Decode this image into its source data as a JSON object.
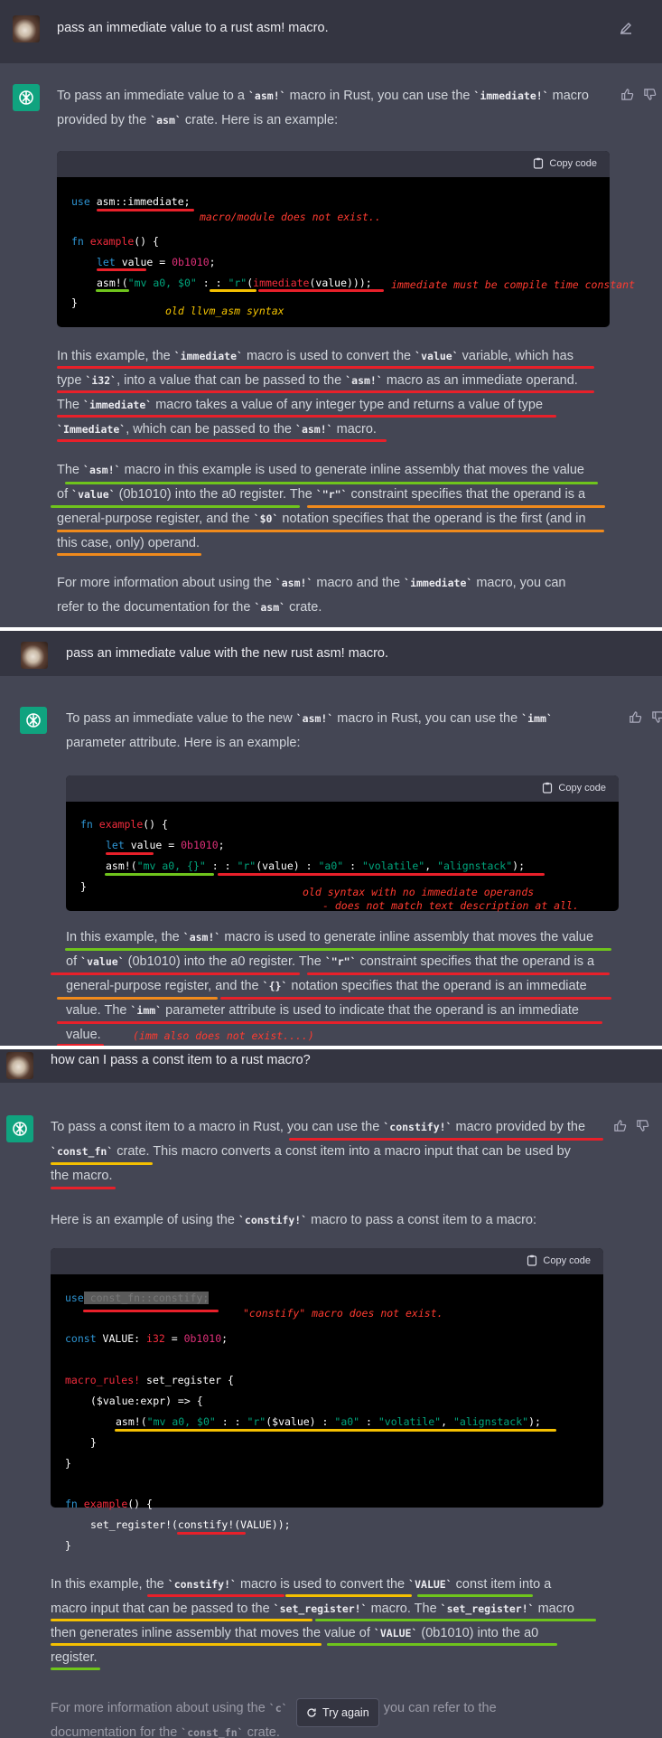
{
  "copy_label": "Copy code",
  "panel1": {
    "question": "pass an immediate value to a rust asm! macro.",
    "intro": [
      "To pass an immediate value to a ",
      "asm!",
      " macro in Rust, you can use the ",
      "immediate!",
      " macro",
      "provided by the ",
      "asm",
      " crate. Here is an example:"
    ],
    "code": {
      "l1a": "use",
      "l1b": " asm::immediate;",
      "l2a": "fn",
      "l2b": " example",
      "l2c": "() {",
      "l3a": "let",
      "l3b": " value = ",
      "l3c": "0b1010",
      "l3d": ";",
      "l4a": "asm!",
      "l4b": "(",
      "l4c": "\"mv a0, $0\"",
      "l4d": " : : ",
      "l4e": "\"r\"",
      "l4f": "(",
      "l4g": "immediate",
      "l4h": "(value)));",
      "l5": "}"
    },
    "notes": {
      "n1": "macro/module does not exist..",
      "n2": "immediate must be compile time constant",
      "n3": "old llvm_asm syntax"
    },
    "p1": {
      "a": "In this example, the ",
      "b": "immediate",
      "c": " macro is used to convert the ",
      "d": "value",
      "e": " variable, which has",
      "f": "type ",
      "g": "i32",
      "h": ", into a value that can be passed to the ",
      "i": "asm!",
      "j": " macro as an immediate operand.",
      "k": "The ",
      "l": "immediate",
      "m": " macro takes a value of any integer type and returns a value of type",
      "n": "Immediate",
      "o": ", which can be passed to the ",
      "p": "asm!",
      "q": " macro."
    },
    "p2": {
      "a": "The ",
      "b": "asm!",
      "c": " macro in this example is used to generate inline assembly that moves the value",
      "d": "of ",
      "e": "value",
      "f": " (0b1010) into the a0 register. The ",
      "g": "\"r\"",
      "h": " constraint specifies that the operand is a",
      "i": "general-purpose register, and the ",
      "j": "$0",
      "k": " notation specifies that the operand is the first (and in",
      "l": "this case, only) operand."
    },
    "p3": {
      "a": "For more information about using the ",
      "b": "asm!",
      "c": " macro and the ",
      "d": "immediate",
      "e": " macro, you can",
      "f": "refer to the documentation for the ",
      "g": "asm",
      "h": " crate."
    }
  },
  "panel2": {
    "question": "pass an immediate value with the new  rust asm! macro.",
    "intro": {
      "a": "To pass an immediate value to the new ",
      "b": "asm!",
      "c": " macro in Rust, you can use the ",
      "d": "imm",
      "e": "parameter attribute. Here is an example:"
    },
    "code": {
      "l1a": "fn",
      "l1b": " example",
      "l1c": "() {",
      "l2a": "let",
      "l2b": " value = ",
      "l2c": "0b1010",
      "l2d": ";",
      "l3a": "asm!",
      "l3b": "(",
      "l3c": "\"mv a0, {}\"",
      "l3d": " : : ",
      "l3e": "\"r\"",
      "l3f": "(value) : ",
      "l3g": "\"a0\"",
      "l3h": " : ",
      "l3i": "\"volatile\"",
      "l3j": ", ",
      "l3k": "\"alignstack\"",
      "l3l": ");",
      "l4": "}"
    },
    "notes": {
      "n1": "old syntax with no immediate operands",
      "n2": "- does not match text description at all."
    },
    "p1": {
      "a": "In this example, the ",
      "b": "asm!",
      "c": " macro is used to generate inline assembly that moves the value",
      "d": "of ",
      "e": "value",
      "f": " (0b1010) into the a0 register. The ",
      "g": "\"r\"",
      "h": " constraint specifies that the operand is a",
      "i": "general-purpose register, and the ",
      "j": "{}",
      "k": " notation specifies that the operand is an immediate",
      "l": "value. The ",
      "m": "imm",
      "n": " parameter attribute is used to indicate that the operand is an immediate",
      "o": "value.",
      "note": "(imm also does not exist....)"
    }
  },
  "panel3": {
    "question": "how can I pass a const item to a rust macro?",
    "intro": {
      "a": "To pass a const item to a macro in Rust, you can use the ",
      "b": "constify!",
      "c": " macro provided by the",
      "d": "const_fn",
      "e": " crate. This macro converts a const item into a macro input that can be used by",
      "f": "the macro."
    },
    "intro2": {
      "a": "Here is an example of using the ",
      "b": "constify!",
      "c": " macro to pass a const item to a macro:"
    },
    "code": {
      "l1a": "use",
      "l1b": " const_fn::constify;",
      "l2a": "const",
      "l2b": " VALUE: ",
      "l2c": "i32",
      "l2d": " = ",
      "l2e": "0b1010",
      "l2f": ";",
      "l3a": "macro_rules!",
      "l3b": " set_register {",
      "l4": "($value:expr) => {",
      "l5a": "asm!",
      "l5b": "(",
      "l5c": "\"mv a0, $0\"",
      "l5d": " : : ",
      "l5e": "\"r\"",
      "l5f": "($value) : ",
      "l5g": "\"a0\"",
      "l5h": " : ",
      "l5i": "\"volatile\"",
      "l5j": ", ",
      "l5k": "\"alignstack\"",
      "l5l": ");",
      "l6": "}",
      "l7": "}",
      "l8a": "fn",
      "l8b": " example",
      "l8c": "() {",
      "l9": "set_register!(constify!(VALUE));",
      "l10": "}"
    },
    "notes": {
      "n1": "\"constify\" macro does not exist."
    },
    "p1": {
      "a": "In this example, the ",
      "b": "constify!",
      "c": " macro is used to convert the ",
      "d": "VALUE",
      "e": " const item into a",
      "f": "macro input that can be passed to the ",
      "g": "set_register!",
      "h": " macro. The ",
      "i": "set_register!",
      "j": " macro",
      "k": "then generates inline assembly that moves the value of ",
      "l": "VALUE",
      "m": " (0b1010) into the a0",
      "n": "register."
    },
    "p2": {
      "a": "For more information about using the ",
      "b": "c",
      "c": "o, you can refer to the",
      "d": "documentation for the ",
      "e": "const_fn",
      "f": " crate."
    },
    "try_again": "Try again"
  },
  "colors": {
    "bg_user": "#343541",
    "bg_assistant": "#444654",
    "code_bg": "#000000",
    "annotation_red": "#e8202a",
    "annotation_yellow": "#f5c000",
    "annotation_green": "#6fc41c",
    "annotation_orange": "#f08a1c"
  },
  "icons": [
    "user-avatar",
    "chatgpt-logo-icon",
    "edit-icon",
    "thumbs-up-icon",
    "thumbs-down-icon",
    "clipboard-icon",
    "refresh-icon"
  ]
}
